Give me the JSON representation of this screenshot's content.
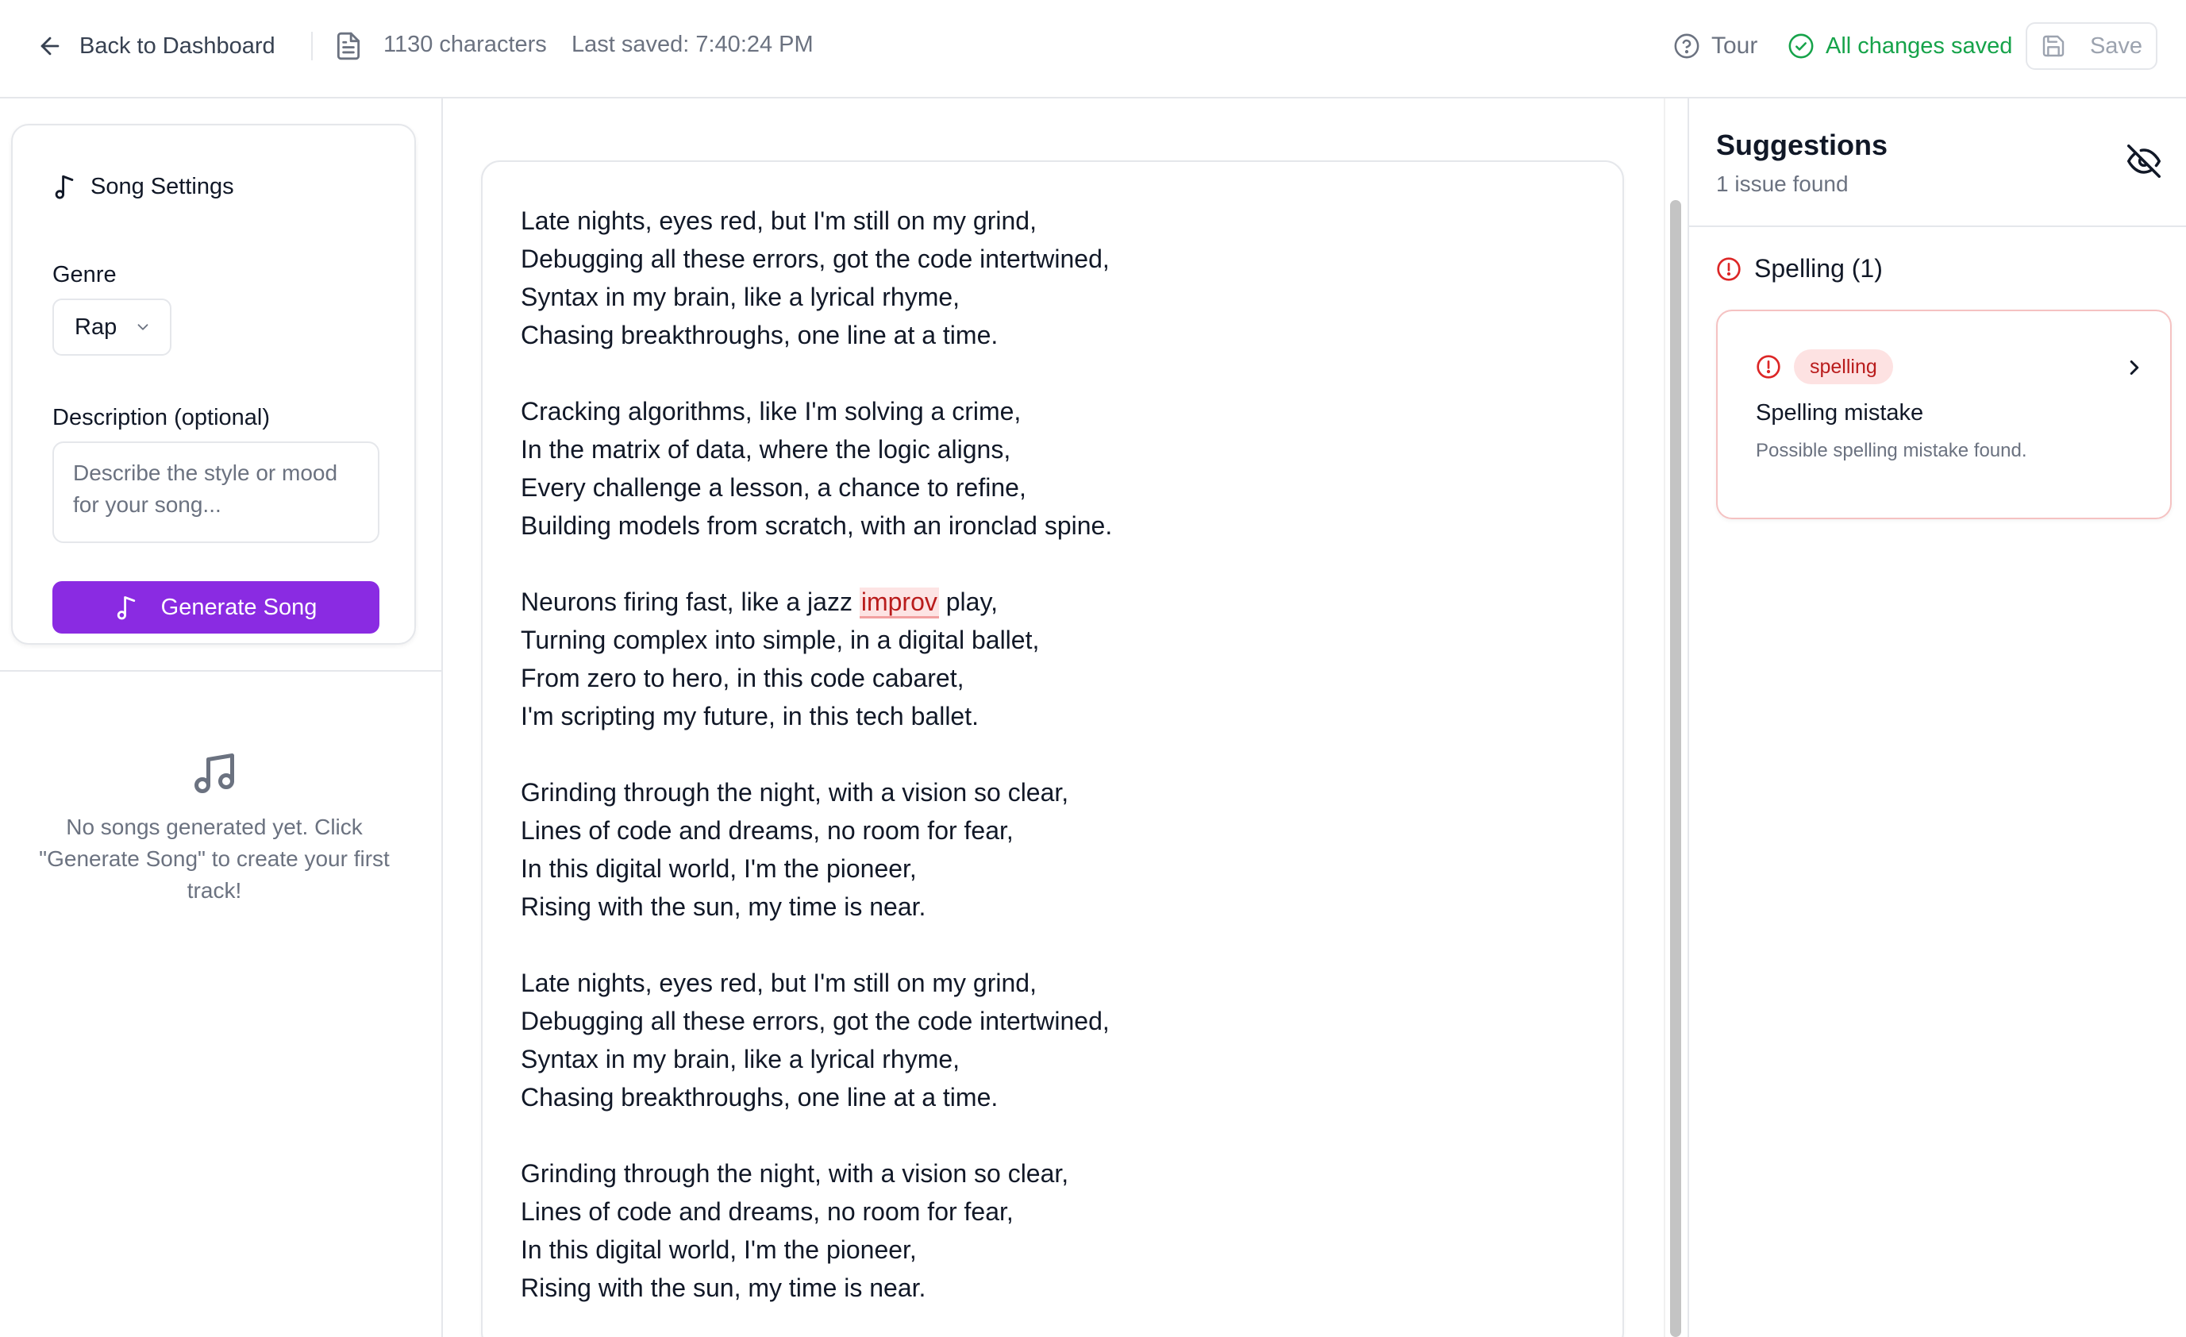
{
  "topbar": {
    "back_label": "Back to Dashboard",
    "char_count": "1130 characters",
    "last_saved": "Last saved: 7:40:24 PM",
    "tour_label": "Tour",
    "status_label": "All changes saved",
    "save_label": "Save"
  },
  "settings": {
    "title": "Song Settings",
    "genre_label": "Genre",
    "genre_value": "Rap",
    "description_label": "Description (optional)",
    "description_placeholder": "Describe the style or mood for your song...",
    "generate_label": "Generate Song",
    "empty_text": "No songs generated yet. Click \"Generate Song\" to create your first track!"
  },
  "editor": {
    "lines": [
      "Late nights, eyes red, but I'm still on my grind,",
      "Debugging all these errors, got the code intertwined,",
      "Syntax in my brain, like a lyrical rhyme,",
      "Chasing breakthroughs, one line at a time.",
      "",
      "Cracking algorithms, like I'm solving a crime,",
      "In the matrix of data, where the logic aligns,",
      "Every challenge a lesson, a chance to refine,",
      "Building models from scratch, with an ironclad spine.",
      "",
      "Neurons firing fast, like a jazz ",
      "Turning complex into simple, in a digital ballet,",
      "From zero to hero, in this code cabaret,",
      "I'm scripting my future, in this tech ballet.",
      "",
      "Grinding through the night, with a vision so clear,",
      "Lines of code and dreams, no room for fear,",
      "In this digital world, I'm the pioneer,",
      "Rising with the sun, my time is near.",
      "",
      "Late nights, eyes red, but I'm still on my grind,",
      "Debugging all these errors, got the code intertwined,",
      "Syntax in my brain, like a lyrical rhyme,",
      "Chasing breakthroughs, one line at a time.",
      "",
      "Grinding through the night, with a vision so clear,",
      "Lines of code and dreams, no room for fear,",
      "In this digital world, I'm the pioneer,",
      "Rising with the sun, my time is near."
    ],
    "flagged_word": "improv",
    "flagged_line_suffix": " play,"
  },
  "suggestions": {
    "title": "Suggestions",
    "count_label": "1 issue found",
    "category_label": "Spelling (1)",
    "issue": {
      "badge": "spelling",
      "title": "Spelling mistake",
      "description": "Possible spelling mistake found."
    }
  },
  "colors": {
    "accent": "#8a2be2",
    "success": "#16a34a",
    "error": "#dc2626",
    "muted": "#6b7280"
  },
  "icons": {
    "back": "arrow-left-icon",
    "document": "document-icon",
    "tour": "help-circle-icon",
    "saved": "check-circle-icon",
    "save": "floppy-disk-icon",
    "music": "music-note-icon",
    "empty": "music-notes-icon",
    "hide": "eye-off-icon",
    "alert": "alert-circle-icon",
    "chevron": "chevron-right-icon"
  }
}
